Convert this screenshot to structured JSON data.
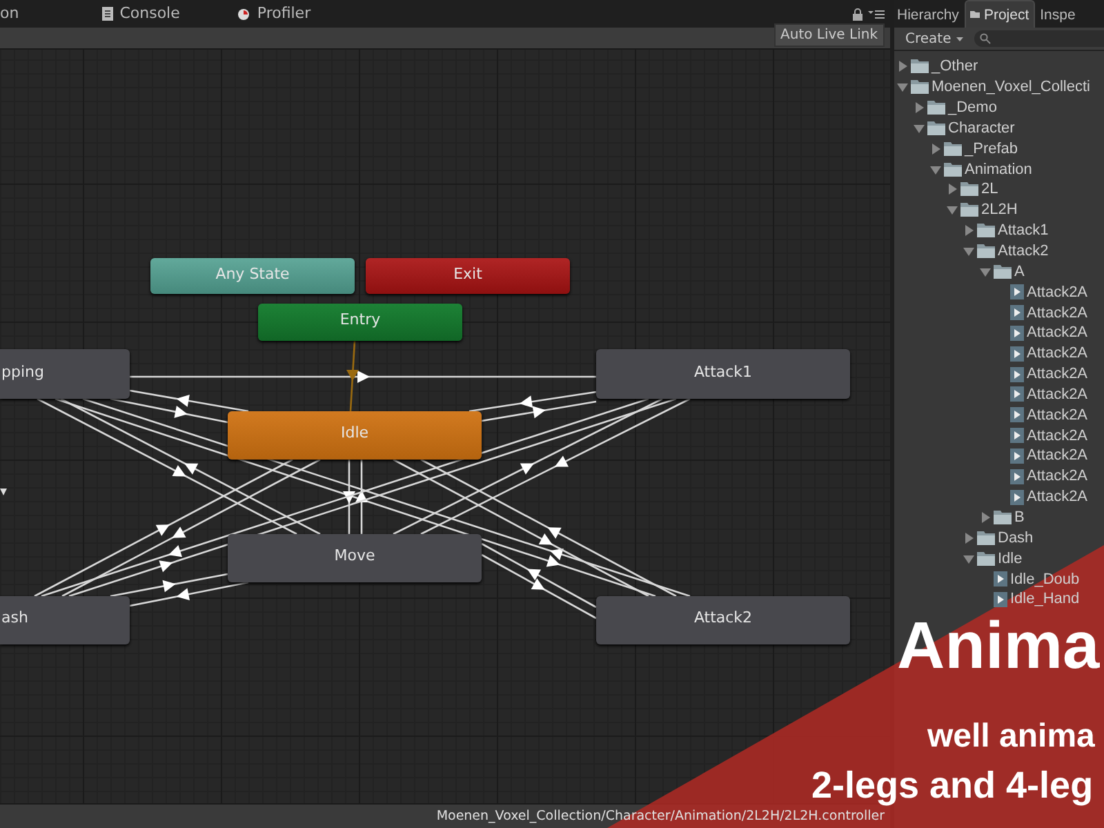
{
  "left_tabs": [
    {
      "label": "on",
      "selected": false
    },
    {
      "label": "Console",
      "selected": false
    },
    {
      "label": "Profiler",
      "selected": false
    }
  ],
  "toolbar": {
    "button": "Auto Live Link"
  },
  "graph": {
    "states": [
      {
        "label": "Any State",
        "kind": "any"
      },
      {
        "label": "Exit",
        "kind": "exit"
      },
      {
        "label": "Entry",
        "kind": "entry"
      },
      {
        "label": "pping",
        "kind": "state"
      },
      {
        "label": "Attack1",
        "kind": "state"
      },
      {
        "label": "Idle",
        "kind": "default"
      },
      {
        "label": "Move",
        "kind": "state"
      },
      {
        "label": "ash",
        "kind": "state"
      },
      {
        "label": "Attack2",
        "kind": "state"
      }
    ]
  },
  "status_bar": {
    "path": "Moenen_Voxel_Collection/Character/Animation/2L2H/2L2H.controller"
  },
  "right_tabs": [
    {
      "label": "Hierarchy",
      "selected": false
    },
    {
      "label": "Project",
      "selected": true
    },
    {
      "label": "Inspe",
      "selected": false
    }
  ],
  "project": {
    "create": "Create",
    "tree": [
      {
        "label": "_Other",
        "kind": "folder",
        "expanded": false
      },
      {
        "label": "Moenen_Voxel_Collecti",
        "kind": "folder",
        "expanded": true,
        "children": [
          {
            "label": "_Demo",
            "kind": "folder",
            "expanded": false
          },
          {
            "label": "Character",
            "kind": "folder",
            "expanded": true,
            "children": [
              {
                "label": "_Prefab",
                "kind": "folder",
                "expanded": false
              },
              {
                "label": "Animation",
                "kind": "folder",
                "expanded": true,
                "children": [
                  {
                    "label": "2L",
                    "kind": "folder",
                    "expanded": false
                  },
                  {
                    "label": "2L2H",
                    "kind": "folder",
                    "expanded": true,
                    "children": [
                      {
                        "label": "Attack1",
                        "kind": "folder",
                        "expanded": false
                      },
                      {
                        "label": "Attack2",
                        "kind": "folder",
                        "expanded": true,
                        "children": [
                          {
                            "label": "A",
                            "kind": "folder",
                            "expanded": true,
                            "children": [
                              {
                                "label": "Attack2A",
                                "kind": "clip"
                              },
                              {
                                "label": "Attack2A",
                                "kind": "clip"
                              },
                              {
                                "label": "Attack2A",
                                "kind": "clip"
                              },
                              {
                                "label": "Attack2A",
                                "kind": "clip"
                              },
                              {
                                "label": "Attack2A",
                                "kind": "clip"
                              },
                              {
                                "label": "Attack2A",
                                "kind": "clip"
                              },
                              {
                                "label": "Attack2A",
                                "kind": "clip"
                              },
                              {
                                "label": "Attack2A",
                                "kind": "clip"
                              },
                              {
                                "label": "Attack2A",
                                "kind": "clip"
                              },
                              {
                                "label": "Attack2A",
                                "kind": "clip"
                              },
                              {
                                "label": "Attack2A",
                                "kind": "clip"
                              }
                            ]
                          },
                          {
                            "label": "B",
                            "kind": "folder",
                            "expanded": false
                          }
                        ]
                      },
                      {
                        "label": "Dash",
                        "kind": "folder",
                        "expanded": false
                      },
                      {
                        "label": "Idle",
                        "kind": "folder",
                        "expanded": true,
                        "children": [
                          {
                            "label": "Idle_Doub",
                            "kind": "clip"
                          },
                          {
                            "label": "Idle_Hand",
                            "kind": "clip"
                          }
                        ]
                      }
                    ]
                  }
                ]
              }
            ]
          }
        ]
      }
    ]
  },
  "banner": {
    "title": "Anima",
    "subtitle": "well anima",
    "caption": "2-legs and 4-leg"
  }
}
